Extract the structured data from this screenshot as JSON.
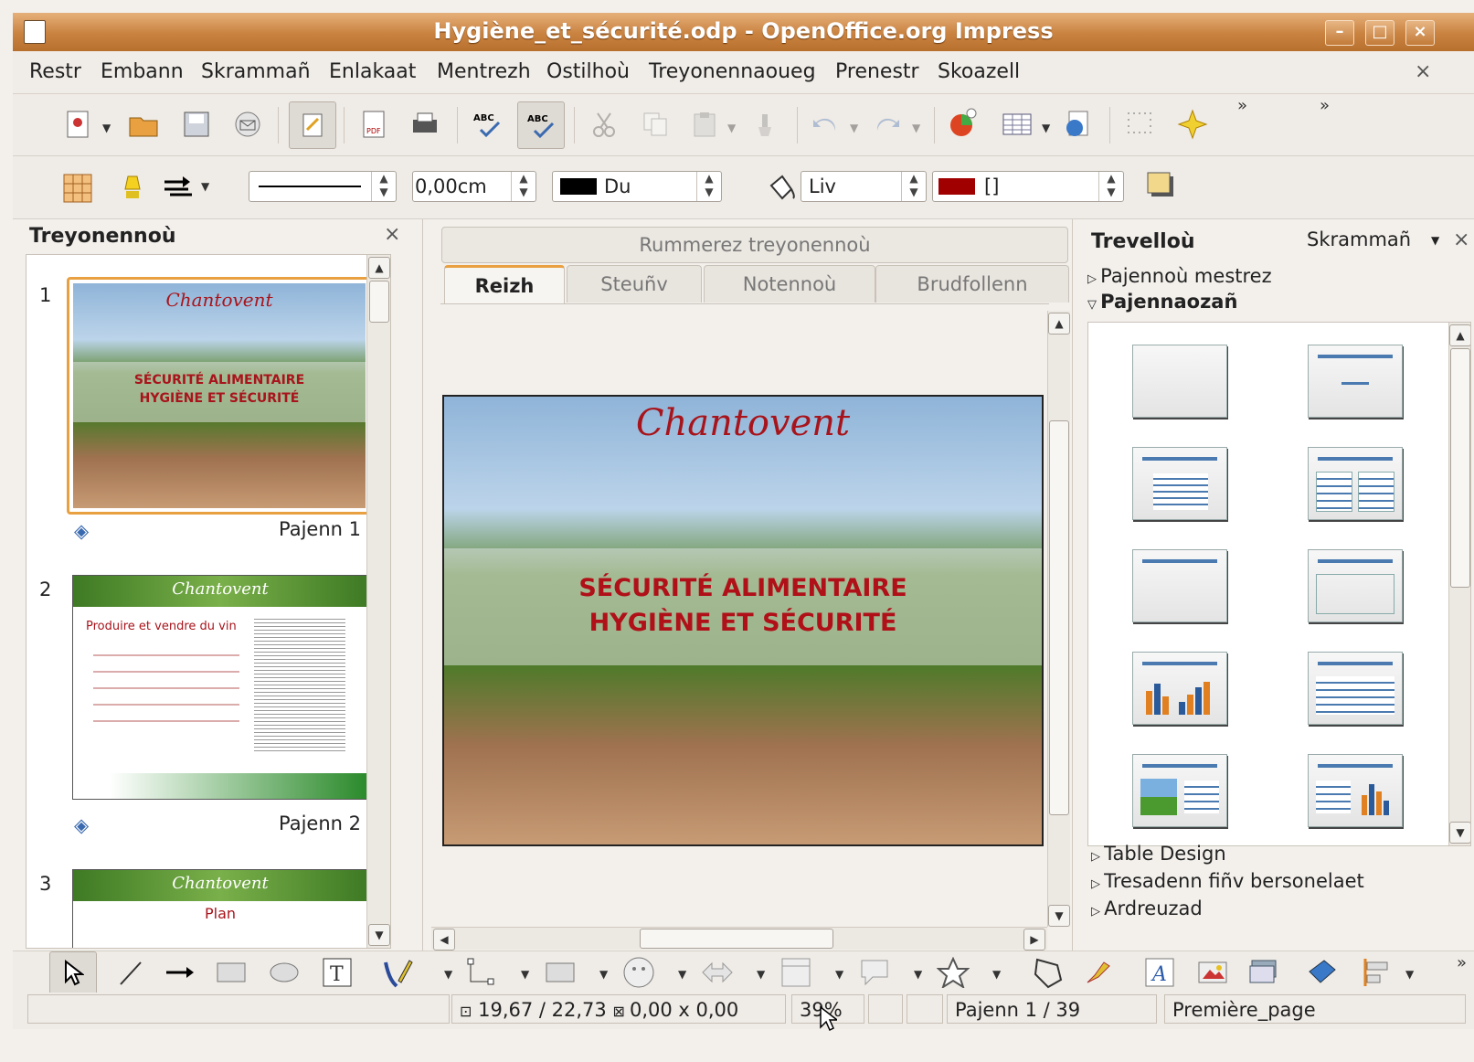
{
  "window": {
    "title": "Hygiène_et_sécurité.odp - OpenOffice.org Impress",
    "close_glyph": "×"
  },
  "menu": [
    "Restr",
    "Embann",
    "Skrammañ",
    "Enlakaat",
    "Mentrezh",
    "Ostilhoù",
    "Treyonennaoueg",
    "Prenestr",
    "Skoazell"
  ],
  "line_toolbar": {
    "line_width": "0,00cm",
    "line_color": "Du",
    "fill_type": "Liv",
    "fill_color": "[]",
    "line_color_hex": "#000000",
    "fill_color_hex": "#a00000"
  },
  "slides_panel": {
    "title": "Treyonennoù",
    "slides": [
      {
        "num": "1",
        "label": "Pajenn 1",
        "logo": "Chantovent",
        "line1": "SÉCURITÉ ALIMENTAIRE",
        "line2": "HYGIÈNE ET SÉCURITÉ"
      },
      {
        "num": "2",
        "label": "Pajenn 2",
        "logo": "Chantovent",
        "heading": "Produire et vendre du vin"
      },
      {
        "num": "3",
        "logo": "Chantovent",
        "heading": "Plan"
      }
    ]
  },
  "editor": {
    "header": "Rummerez treyonennoù",
    "tabs": [
      "Reizh",
      "Steuñv",
      "Notennoù",
      "Brudfollenn"
    ],
    "active_tab": "Reizh",
    "slide": {
      "logo": "Chantovent",
      "line1": "SÉCURITÉ ALIMENTAIRE",
      "line2": "HYGIÈNE ET SÉCURITÉ"
    }
  },
  "tasks_panel": {
    "title": "Trevelloù",
    "view_menu": "Skrammañ",
    "sections": [
      "Pajennoù mestrez",
      "Pajennaozañ",
      "Table Design",
      "Tresadenn fiñv bersonelaet",
      "Ardreuzad"
    ],
    "expanded": "Pajennaozañ"
  },
  "statusbar": {
    "position": "19,67 / 22,73",
    "size": "0,00 x 0,00",
    "zoom": "39%",
    "page": "Pajenn 1 / 39",
    "master": "Première_page"
  },
  "colors": {
    "title_bar": "#c9823f",
    "slide_red": "#a8141b",
    "active_thumb_border": "#e8a040"
  }
}
